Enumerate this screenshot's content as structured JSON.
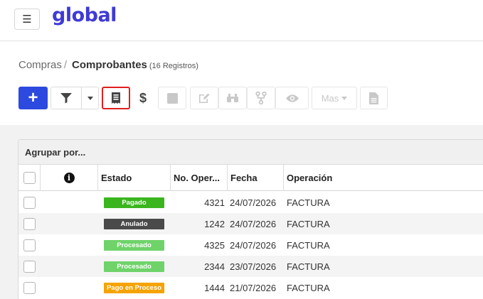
{
  "app": {
    "logo": "global",
    "menu_icon": "hamburger-icon"
  },
  "breadcrumb": {
    "parent": "Compras",
    "separator": "/",
    "current": "Comprobantes",
    "count": "(16 Registros)"
  },
  "toolbar": {
    "add_label": "+",
    "more_label": "Mas",
    "dollar_label": "$"
  },
  "grid": {
    "group_by": "Agrupar por...",
    "columns": {
      "estado": "Estado",
      "no_oper": "No. Oper...",
      "fecha": "Fecha",
      "operacion": "Operación"
    },
    "rows": [
      {
        "estado": "Pagado",
        "estado_color": "#3ab51e",
        "no_oper": "4321",
        "fecha": "24/07/2026",
        "operacion": "FACTURA"
      },
      {
        "estado": "Anulado",
        "estado_color": "#4a4a4a",
        "no_oper": "1242",
        "fecha": "24/07/2026",
        "operacion": "FACTURA"
      },
      {
        "estado": "Procesado",
        "estado_color": "#6fd36a",
        "no_oper": "4325",
        "fecha": "24/07/2026",
        "operacion": "FACTURA"
      },
      {
        "estado": "Procesado",
        "estado_color": "#6fd36a",
        "no_oper": "2344",
        "fecha": "23/07/2026",
        "operacion": "FACTURA"
      },
      {
        "estado": "Pago en Proceso",
        "estado_color": "#f5a300",
        "no_oper": "1444",
        "fecha": "21/07/2026",
        "operacion": "FACTURA"
      }
    ]
  },
  "colors": {
    "brand": "#3f3ad6",
    "primary_button": "#2c49e0",
    "highlight_border": "#e02020"
  }
}
